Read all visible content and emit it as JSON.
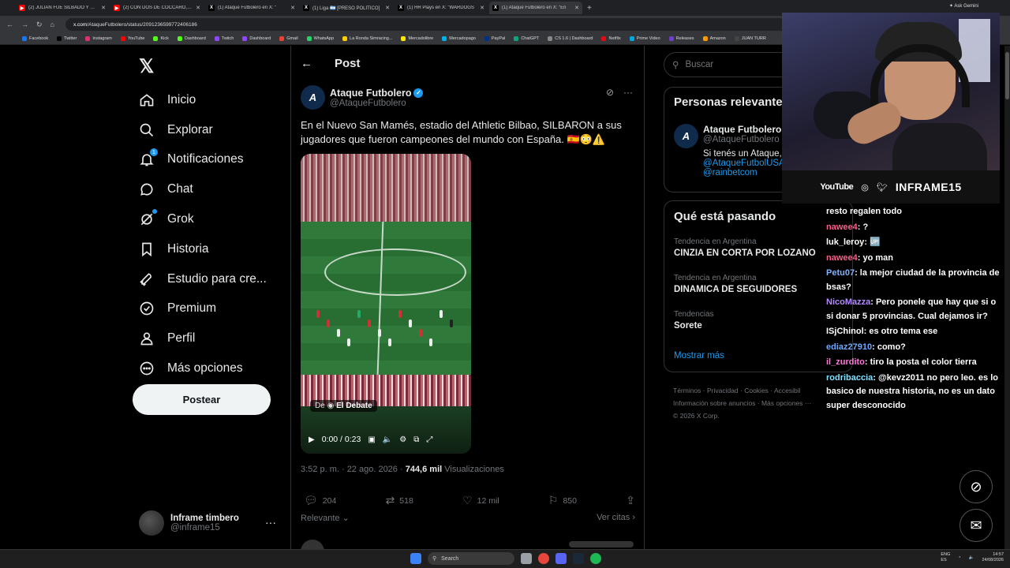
{
  "browser": {
    "tabs": [
      {
        "title": "(2) JULIÁN FUE SILBADO Y GIU",
        "fav": "yt",
        "color": "#ff0000"
      },
      {
        "title": "(2) CON DOS DE CÓCCARO, NE",
        "fav": "yt",
        "color": "#ff0000"
      },
      {
        "title": "(1) Ataque Futbolero en X: \"",
        "fav": "x",
        "color": "#000000"
      },
      {
        "title": "(1) Liga 🇦🇷 [PRESO POLÍTICO]",
        "fav": "x",
        "color": "#000000"
      },
      {
        "title": "(1) HR Plays en X: \"WARDOGS",
        "fav": "x",
        "color": "#000000"
      },
      {
        "title": "(1) Ataque Futbolero en X: \"En",
        "fav": "x",
        "color": "#000000",
        "active": true
      }
    ],
    "ask_label": "Ask Gemini",
    "url_domain": "x.com",
    "url_path": "/AtaqueFutbolero/status/2091236599772406186",
    "bookmarks": [
      {
        "label": "Facebook",
        "color": "#1877f2"
      },
      {
        "label": "Twitter",
        "color": "#000000"
      },
      {
        "label": "Instagram",
        "color": "#e1306c"
      },
      {
        "label": "YouTube",
        "color": "#ff0000"
      },
      {
        "label": "Kick",
        "color": "#53fc18"
      },
      {
        "label": "Dashboard",
        "color": "#53fc18"
      },
      {
        "label": "Twitch",
        "color": "#9146ff"
      },
      {
        "label": "Dashboard",
        "color": "#9146ff"
      },
      {
        "label": "Gmail",
        "color": "#ea4335"
      },
      {
        "label": "WhatsApp",
        "color": "#25d366"
      },
      {
        "label": "La Ronda Simracing...",
        "color": "#ffcc00"
      },
      {
        "label": "Mercadolibre",
        "color": "#ffe600"
      },
      {
        "label": "Mercadopago",
        "color": "#00b1ea"
      },
      {
        "label": "PayPal",
        "color": "#003087"
      },
      {
        "label": "ChatGPT",
        "color": "#10a37f"
      },
      {
        "label": "CS 1.6 | Dashboard",
        "color": "#888888"
      },
      {
        "label": "Netflix",
        "color": "#e50914"
      },
      {
        "label": "Prime Video",
        "color": "#00a8e1"
      },
      {
        "label": "Releases",
        "color": "#6e40c9"
      },
      {
        "label": "Amazon",
        "color": "#ff9900"
      },
      {
        "label": "JUAN TURR",
        "color": "#444444"
      }
    ]
  },
  "nav": {
    "items": [
      {
        "label": "Inicio",
        "icon": "home-icon"
      },
      {
        "label": "Explorar",
        "icon": "search-icon"
      },
      {
        "label": "Notificaciones",
        "icon": "bell-icon",
        "badge": "1"
      },
      {
        "label": "Chat",
        "icon": "chat-icon"
      },
      {
        "label": "Grok",
        "icon": "grok-icon",
        "dot": true
      },
      {
        "label": "Historia",
        "icon": "bookmark-icon"
      },
      {
        "label": "Estudio para cre...",
        "icon": "rocket-icon"
      },
      {
        "label": "Premium",
        "icon": "verified-icon"
      },
      {
        "label": "Perfil",
        "icon": "person-icon"
      },
      {
        "label": "Más opciones",
        "icon": "more-circle-icon"
      }
    ],
    "post_label": "Postear",
    "account_name": "Inframe timbero",
    "account_handle": "@inframe15"
  },
  "post": {
    "header": "Post",
    "author_name": "Ataque Futbolero",
    "author_handle": "@AtaqueFutbolero",
    "text": "En el Nuevo San Mamés, estadio del Athletic Bilbao, SILBARON a sus jugadores que fueron campeones del mundo con España. 🇪🇸😳⚠️",
    "video_source_prefix": "De",
    "video_source": "El Debate",
    "video_time": "0:00 / 0:23",
    "timestamp": "3:52 p. m. · 22 ago. 2026 ·",
    "views_count": "744,6 mil",
    "views_label": "Visualizaciones",
    "replies": "204",
    "reposts": "518",
    "likes": "12 mil",
    "bookmarks": "850",
    "sort_label": "Relevante",
    "quotes_label": "Ver citas"
  },
  "right": {
    "search_placeholder": "Buscar",
    "relevant_title": "Personas relevantes",
    "relevant_name": "Ataque Futbolero",
    "relevant_handle": "@AtaqueFutbolero",
    "relevant_bio": "Si tenés un Ataque,",
    "relevant_link1": "@AtaqueFutbolUSA",
    "relevant_link2": "@rainbetcom",
    "trends_title": "Qué está pasando",
    "trends": [
      {
        "label": "Tendencia en Argentina",
        "name": "CINZIA EN CORTA POR LOZANO"
      },
      {
        "label": "Tendencia en Argentina",
        "name": "DINAMICA DE SEGUIDORES"
      },
      {
        "label": "Tendencias",
        "name": "Sorete"
      }
    ],
    "show_more": "Mostrar más",
    "footer_line1": "Términos · Privacidad · Cookies · Accesibil",
    "footer_line2": "Información sobre anuncios · Más opciones ···",
    "footer_line3": "© 2026 X Corp."
  },
  "stream": {
    "youtube_label": "YouTube",
    "brand": "INFRAME15",
    "chat": [
      {
        "user": "",
        "color": "#ffffff",
        "text": "resto regalen todo"
      },
      {
        "user": "nawee4",
        "color": "#ff5c8a",
        "text": ": ?"
      },
      {
        "user": "luk_leroy",
        "color": "#ffffff",
        "text": ": 🆙"
      },
      {
        "user": "nawee4",
        "color": "#ff5c8a",
        "text": ": yo man"
      },
      {
        "user": "Petu07",
        "color": "#7fb2ff",
        "text": ": la mejor ciudad de la provincia de bsas?"
      },
      {
        "user": "NicoMazza",
        "color": "#b48cff",
        "text": ": Pero ponele que hay que si o si donar 5 provincias. Cual dejamos ir?"
      },
      {
        "user": "ISjChinol",
        "color": "#ffffff",
        "text": ": es otro tema ese"
      },
      {
        "user": "ediaz27910",
        "color": "#6fa8ff",
        "text": ": como?"
      },
      {
        "user": "il_zurdito",
        "color": "#ff7ad9",
        "text": ": tiro la posta el color tierra"
      },
      {
        "user": "rodribaccia",
        "color": "#7fe3ff",
        "text": ": @kevz2011 no pero leo. es lo basico de nuestra historia, no es un dato super desconocido"
      }
    ]
  },
  "taskbar": {
    "search_label": "Search",
    "lang1": "ENG",
    "lang2": "ES",
    "time": "14:57",
    "date": "24/08/2026"
  }
}
